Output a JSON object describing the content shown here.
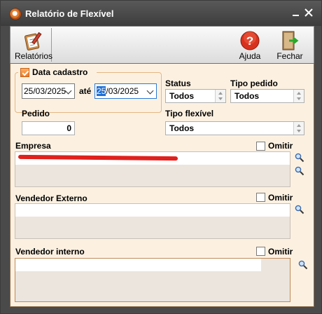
{
  "window": {
    "title": "Relatório de Flexível"
  },
  "toolbar": {
    "reports_label": "Relatórios",
    "help_label": "Ajuda",
    "close_label": "Fechar"
  },
  "filters": {
    "date_group_label": "Data cadastro",
    "date_from": "25/03/2025",
    "date_to_selected": "25",
    "date_to_rest": "/03/2025",
    "date_separator": "até",
    "status_label": "Status",
    "status_value": "Todos",
    "order_type_label": "Tipo pedido",
    "order_type_value": "Todos",
    "order_label": "Pedido",
    "order_value": "0",
    "flex_type_label": "Tipo flexível",
    "flex_type_value": "Todos"
  },
  "empresa": {
    "label": "Empresa",
    "omit_label": "Omitir"
  },
  "vendedor_externo": {
    "label": "Vendedor Externo",
    "omit_label": "Omitir"
  },
  "vendedor_interno": {
    "label": "Vendedor interno",
    "omit_label": "Omitir"
  },
  "colors": {
    "accent": "#f07a20",
    "panel_bg": "#fcf1e1",
    "titlebar": "#4a4a4a"
  }
}
